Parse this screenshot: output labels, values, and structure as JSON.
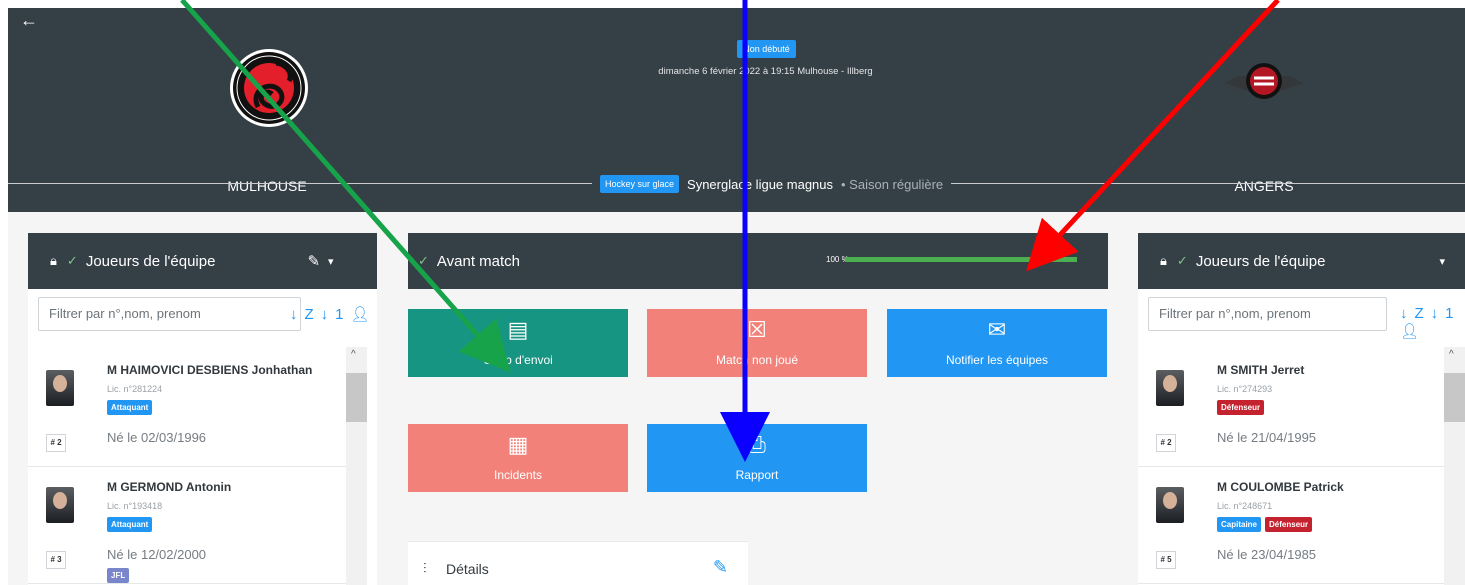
{
  "header": {
    "back_icon": "arrow-left-icon",
    "status": "Non débuté",
    "datetime_venue": "dimanche 6 février 2022 à 19:15 Mulhouse - Illberg",
    "home_team": "MULHOUSE",
    "away_team": "ANGERS",
    "sport": "Hockey sur glace",
    "competition": "Synerglace ligue magnus",
    "season": "• Saison régulière"
  },
  "left_panel": {
    "title": "Joueurs de l'équipe",
    "filter_placeholder": "Filtrer par n°,nom, prenom",
    "players": [
      {
        "number": "# 2",
        "name": "M HAIMOVICI DESBIENS Jonhathan",
        "license": "Lic. n°281224",
        "badges": [
          "Attaquant"
        ],
        "birth": "Né le 02/03/1996"
      },
      {
        "number": "# 3",
        "name": "M GERMOND Antonin",
        "license": "Lic. n°193418",
        "badges": [
          "Attaquant",
          "JFL"
        ],
        "birth": "Né le 12/02/2000"
      }
    ]
  },
  "right_panel": {
    "title": "Joueurs de l'équipe",
    "filter_placeholder": "Filtrer par n°,nom, prenom",
    "players": [
      {
        "number": "# 2",
        "name": "M SMITH Jerret",
        "license": "Lic. n°274293",
        "badges": [
          "Défenseur"
        ],
        "birth": "Né le 21/04/1995"
      },
      {
        "number": "# 5",
        "name": "M COULOMBE Patrick",
        "license": "Lic. n°248671",
        "badges": [
          "Capitaine",
          "Défenseur"
        ],
        "birth": "Né le 23/04/1985"
      }
    ]
  },
  "center": {
    "title": "Avant match",
    "progress_label": "100 %",
    "progress_value": 100,
    "tiles": [
      {
        "label": "Coup d'envoi",
        "icon": "document-stack-icon"
      },
      {
        "label": "Match non joué",
        "icon": "cancel-document-icon"
      },
      {
        "label": "Notifier les équipes",
        "icon": "envelope-icon"
      },
      {
        "label": "Incidents",
        "icon": "newspaper-icon"
      },
      {
        "label": "Rapport",
        "icon": "pdf-icon"
      }
    ],
    "details_label": "Détails"
  },
  "colors": {
    "header": "#353f46",
    "blue": "#2196f3",
    "green_tile": "#169582",
    "salmon_tile": "#f2817a",
    "progress": "#4caf50",
    "arrow_green": "#16a34a",
    "arrow_blue": "#0b00ff",
    "arrow_red": "#ff0000"
  }
}
